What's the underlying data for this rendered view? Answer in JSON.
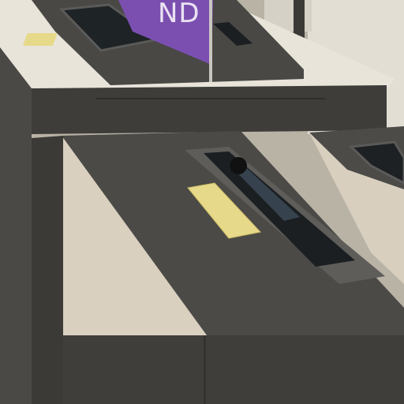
{
  "scene": {
    "description_visible_text": {
      "purple_sign": "ND"
    },
    "colors": {
      "wall": "#e8e2d6",
      "gate_top": "#4b4a47",
      "gate_side_light": "#d9d0c0",
      "gate_front_dark": "#3f3e3b",
      "sign_purple": "#7b4fb0",
      "ticket_yellow": "#e7d98a",
      "reader_black": "#1d2124"
    }
  }
}
